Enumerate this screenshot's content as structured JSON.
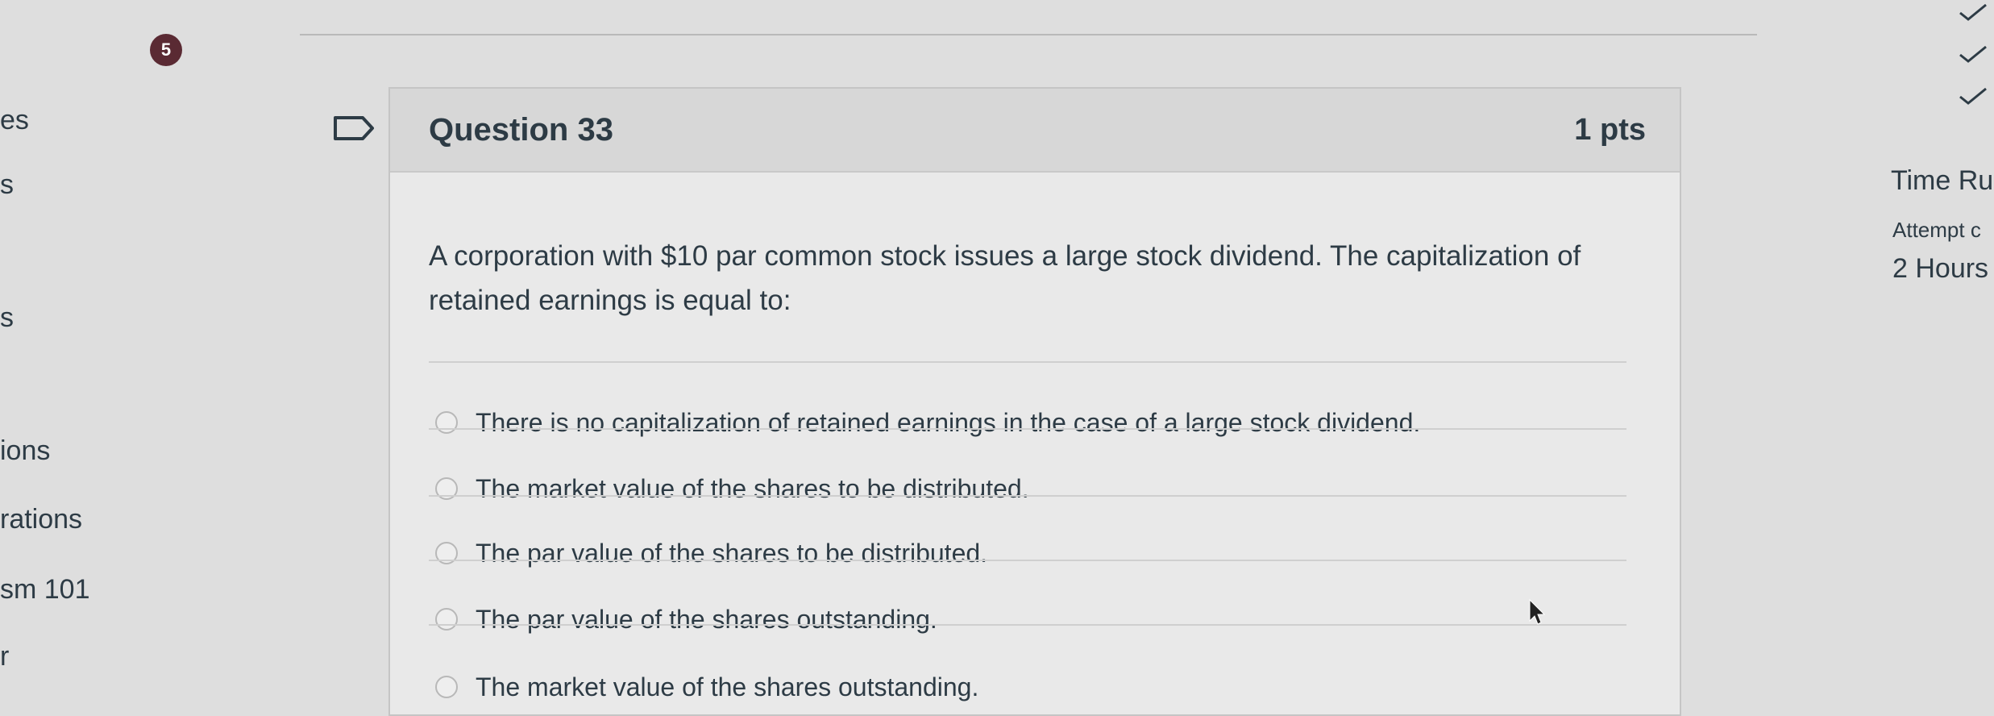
{
  "sidebar": {
    "items": [
      "es",
      "s",
      "s",
      "ions",
      "rations",
      "sm 101",
      "r"
    ]
  },
  "progress": {
    "badge": "5"
  },
  "question": {
    "title": "Question 33",
    "points": "1 pts",
    "text": "A corporation with $10 par common stock issues a large stock dividend. The capitalization of retained earnings is equal to:",
    "answers": [
      "There is no capitalization of retained earnings in the case of a large stock dividend.",
      "The market value of the shares to be distributed.",
      "The par value of the shares to be distributed.",
      "The par value of the shares outstanding.",
      "The market value of the shares outstanding."
    ]
  },
  "right_panel": {
    "time_running": "Time Ru",
    "attempt": "Attempt c",
    "hours": "2 Hours"
  },
  "icons": {
    "flag": "flag-icon",
    "check": "check-icon",
    "cursor": "cursor-icon"
  }
}
